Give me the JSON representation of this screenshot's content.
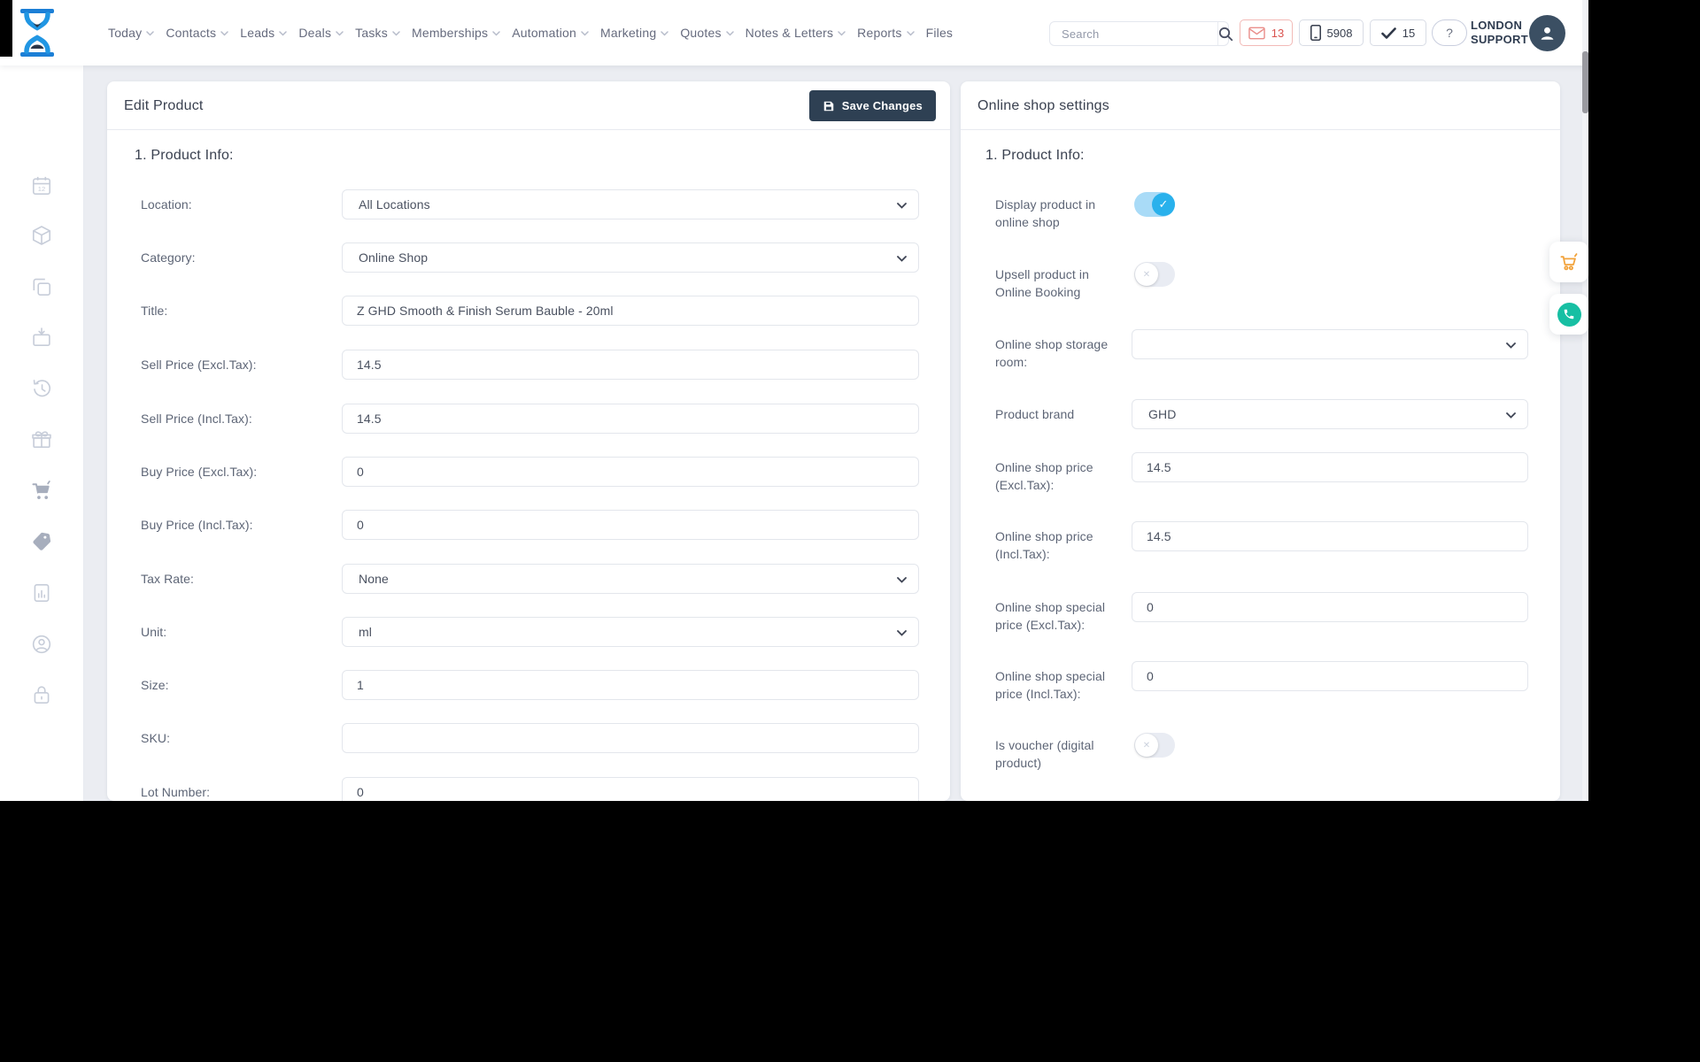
{
  "header": {
    "nav": [
      {
        "label": "Today"
      },
      {
        "label": "Contacts"
      },
      {
        "label": "Leads"
      },
      {
        "label": "Deals"
      },
      {
        "label": "Tasks"
      },
      {
        "label": "Memberships"
      },
      {
        "label": "Automation"
      },
      {
        "label": "Marketing"
      },
      {
        "label": "Quotes"
      },
      {
        "label": "Notes & Letters"
      },
      {
        "label": "Reports"
      },
      {
        "label": "Files"
      }
    ],
    "search": {
      "placeholder": "Search"
    },
    "badges": {
      "mail_count": "13",
      "phone_number": "5908",
      "tasks_count": "15",
      "help": "?"
    },
    "user": {
      "line1": "LONDON",
      "line2": "SUPPORT"
    }
  },
  "sidebar": {
    "icons": [
      "calendar-icon",
      "package-icon",
      "copy-icon",
      "box-icon",
      "history-icon",
      "gift-icon",
      "cart-icon",
      "tag-icon",
      "report-icon",
      "customer-icon",
      "lock-icon"
    ]
  },
  "edit_product": {
    "title": "Edit Product",
    "save_label": "Save Changes",
    "section": "1. Product Info:",
    "fields": [
      {
        "label": "Location:",
        "type": "select",
        "value": "All Locations"
      },
      {
        "label": "Category:",
        "type": "select",
        "value": "Online Shop"
      },
      {
        "label": "Title:",
        "type": "text",
        "value": "Z GHD Smooth & Finish Serum Bauble - 20ml"
      },
      {
        "label": "Sell Price (Excl.Tax):",
        "type": "text",
        "value": "14.5"
      },
      {
        "label": "Sell Price (Incl.Tax):",
        "type": "text",
        "value": "14.5"
      },
      {
        "label": "Buy Price (Excl.Tax):",
        "type": "text",
        "value": "0"
      },
      {
        "label": "Buy Price (Incl.Tax):",
        "type": "text",
        "value": "0"
      },
      {
        "label": "Tax Rate:",
        "type": "select",
        "value": "None"
      },
      {
        "label": "Unit:",
        "type": "select",
        "value": "ml"
      },
      {
        "label": "Size:",
        "type": "text",
        "value": "1"
      },
      {
        "label": "SKU:",
        "type": "text",
        "value": ""
      },
      {
        "label": "Lot Number:",
        "type": "text",
        "value": "0"
      }
    ]
  },
  "online_shop": {
    "title": "Online shop settings",
    "section": "1. Product Info:",
    "fields": [
      {
        "label": "Display product in online shop",
        "type": "toggle",
        "state": "on"
      },
      {
        "label": "Upsell product in Online Booking",
        "type": "toggle",
        "state": "off"
      },
      {
        "label": "Online shop storage room:",
        "type": "select",
        "value": ""
      },
      {
        "label": "Product brand",
        "type": "select",
        "value": "GHD"
      },
      {
        "label": "Online shop price (Excl.Tax):",
        "type": "text",
        "value": "14.5"
      },
      {
        "label": "Online shop price (Incl.Tax):",
        "type": "text",
        "value": "14.5"
      },
      {
        "label": "Online shop special price (Excl.Tax):",
        "type": "text",
        "value": "0"
      },
      {
        "label": "Online shop special price (Incl.Tax):",
        "type": "text",
        "value": "0"
      },
      {
        "label": "Is voucher (digital product)",
        "type": "toggle",
        "state": "off"
      }
    ]
  },
  "colors": {
    "accent_blue": "#29b1ec",
    "toggle_track_on": "#a9dbf7",
    "save_button": "#2e4053",
    "alert_red": "#d9534f",
    "cart_orange": "#f2a33c",
    "phone_teal": "#17bfa3",
    "body_bg": "#ebedf2"
  }
}
